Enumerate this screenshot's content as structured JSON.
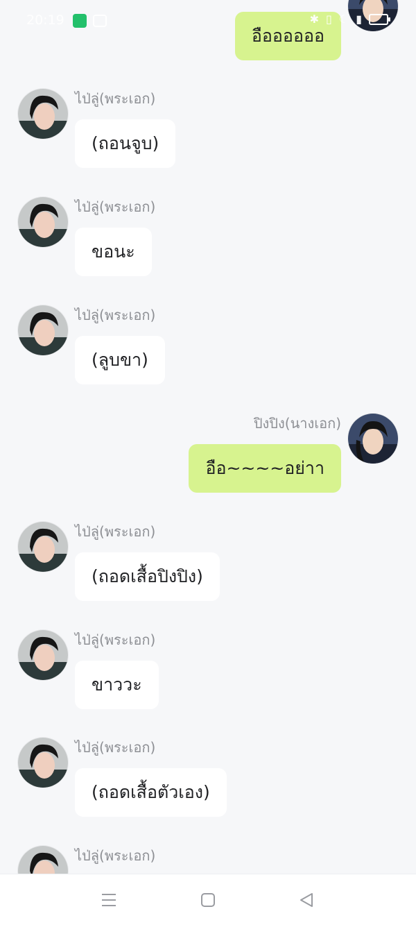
{
  "status_bar": {
    "time": "20:19",
    "icons": [
      "app-icon-green",
      "video-icon",
      "bluetooth-icon",
      "vibrate-icon",
      "moon-icon",
      "signal-icon",
      "battery-icon"
    ],
    "battery_level": "6"
  },
  "chat": {
    "messages": [
      {
        "side": "right",
        "sender": "",
        "text": "อืออออออ"
      },
      {
        "side": "left",
        "sender": "ไป่ลู่(พระเอก)",
        "text": "(ถอนจูบ)"
      },
      {
        "side": "left",
        "sender": "ไป่ลู่(พระเอก)",
        "text": "ขอนะ"
      },
      {
        "side": "left",
        "sender": "ไป่ลู่(พระเอก)",
        "text": "(ลูบขา)"
      },
      {
        "side": "right",
        "sender": "ปิงปิง(นางเอก)",
        "text": "อือ~~~~อย่าา"
      },
      {
        "side": "left",
        "sender": "ไป่ลู่(พระเอก)",
        "text": "(ถอดเสื้อปิงปิง)"
      },
      {
        "side": "left",
        "sender": "ไป่ลู่(พระเอก)",
        "text": "ขาววะ"
      },
      {
        "side": "left",
        "sender": "ไป่ลู่(พระเอก)",
        "text": "(ถอดเสื้อตัวเอง)"
      },
      {
        "side": "left",
        "sender": "ไป่ลู่(พระเอก)",
        "text": ""
      }
    ]
  },
  "nav": {
    "icons": [
      "menu-icon",
      "home-icon",
      "back-icon"
    ]
  },
  "colors": {
    "background": "#f6f7f9",
    "bubble_left": "#ffffff",
    "bubble_right": "#d7f38f",
    "name_text": "#8d8f94"
  }
}
